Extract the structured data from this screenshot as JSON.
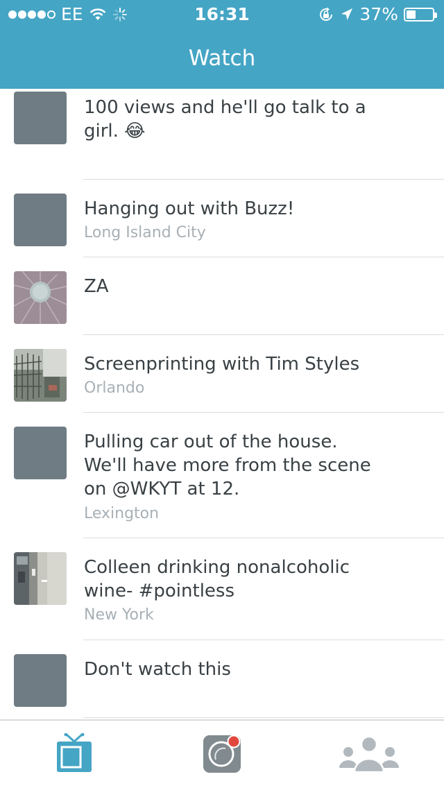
{
  "status_bar": {
    "carrier": "EE",
    "time": "16:31",
    "battery_percent": "37%",
    "battery_level": 0.37,
    "signal_bars_filled": 4,
    "signal_bars_total": 5,
    "icons": [
      "signal-dots-icon",
      "wifi-icon",
      "activity-spinner-icon",
      "rotation-lock-icon",
      "location-arrow-icon",
      "battery-icon"
    ]
  },
  "header": {
    "title": "Watch",
    "background": "#45a5c5"
  },
  "feed": {
    "items": [
      {
        "title": "100 views and he'll go talk to a girl.",
        "emoji": "😂",
        "location": "",
        "thumbnail": "gray-placeholder"
      },
      {
        "title": "Hanging out with Buzz!",
        "location": "Long Island City",
        "thumbnail": "gray-placeholder"
      },
      {
        "title": "ZA",
        "location": "",
        "thumbnail": "pizza-photo"
      },
      {
        "title": "Screenprinting with Tim Styles",
        "location": "Orlando",
        "thumbnail": "workshop-photo"
      },
      {
        "title": "Pulling car out of the house. We'll have more from the scene on @WKYT at 12.",
        "location": "Lexington",
        "thumbnail": "gray-placeholder"
      },
      {
        "title": "Colleen drinking nonalcoholic wine- #pointless",
        "location": "New York",
        "thumbnail": "room-photo"
      },
      {
        "title": "Don't watch this",
        "location": "",
        "thumbnail": "gray-placeholder"
      }
    ]
  },
  "tab_bar": {
    "tabs": [
      {
        "name": "watch",
        "icon": "tv-icon",
        "selected": true
      },
      {
        "name": "broadcast",
        "icon": "broadcast-camera-icon",
        "selected": false
      },
      {
        "name": "people",
        "icon": "people-icon",
        "selected": false
      }
    ]
  },
  "colors": {
    "accent": "#45a5c5",
    "text": "#394044",
    "muted": "#a8b0b5",
    "placeholder": "#6f7c83",
    "broadcast_dot": "#e0483e"
  }
}
